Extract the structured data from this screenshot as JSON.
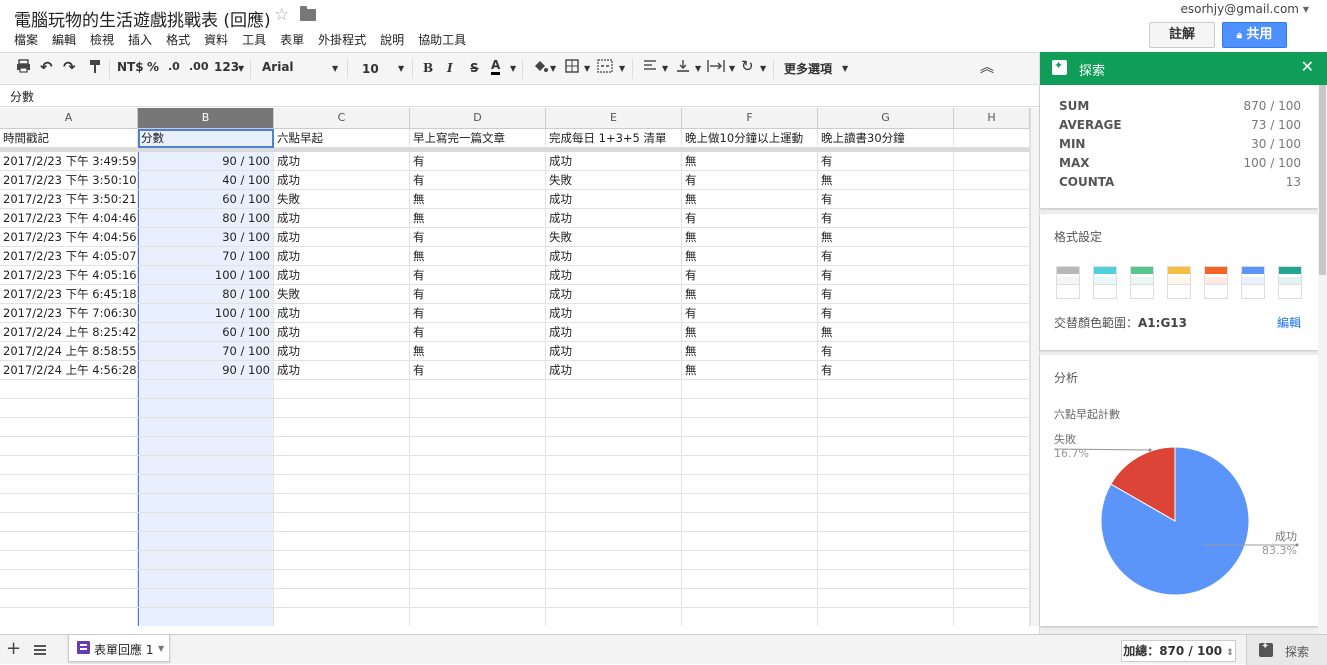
{
  "doc": {
    "title": "電腦玩物的生活遊戲挑戰表 (回應)"
  },
  "menu": [
    "檔案",
    "編輯",
    "檢視",
    "插入",
    "格式",
    "資料",
    "工具",
    "表單",
    "外掛程式",
    "說明",
    "協助工具"
  ],
  "user": {
    "email": "esorhjy@gmail.com"
  },
  "buttons": {
    "comments": "註解",
    "share": "共用"
  },
  "toolbar": {
    "currency": "NT$",
    "percent": "%",
    "dec_less": ".0",
    "dec_more": ".00",
    "format": "123",
    "font": "Arial",
    "size": "10",
    "bold": "B",
    "italic": "I",
    "strike": "S",
    "text_color": "A",
    "more": "更多選項"
  },
  "formula": {
    "value": "分數"
  },
  "grid": {
    "columns": [
      "A",
      "B",
      "C",
      "D",
      "E",
      "F",
      "G",
      "H"
    ],
    "header": [
      "時間戳記",
      "分數",
      "六點早起",
      "早上寫完一篇文章",
      "完成每日 1+3+5 清單",
      "晚上做10分鐘以上運動",
      "晚上讀書30分鐘"
    ],
    "rows": [
      [
        "2017/2/23 下午 3:49:59",
        "90 / 100",
        "成功",
        "有",
        "成功",
        "無",
        "有"
      ],
      [
        "2017/2/23 下午 3:50:10",
        "40 / 100",
        "成功",
        "有",
        "失敗",
        "有",
        "無"
      ],
      [
        "2017/2/23 下午 3:50:21",
        "60 / 100",
        "失敗",
        "無",
        "成功",
        "無",
        "有"
      ],
      [
        "2017/2/23 下午 4:04:46",
        "80 / 100",
        "成功",
        "無",
        "成功",
        "有",
        "有"
      ],
      [
        "2017/2/23 下午 4:04:56",
        "30 / 100",
        "成功",
        "有",
        "失敗",
        "無",
        "無"
      ],
      [
        "2017/2/23 下午 4:05:07",
        "70 / 100",
        "成功",
        "無",
        "成功",
        "無",
        "有"
      ],
      [
        "2017/2/23 下午 4:05:16",
        "100 / 100",
        "成功",
        "有",
        "成功",
        "有",
        "有"
      ],
      [
        "2017/2/23 下午 6:45:18",
        "80 / 100",
        "失敗",
        "有",
        "成功",
        "無",
        "有"
      ],
      [
        "2017/2/23 下午 7:06:30",
        "100 / 100",
        "成功",
        "有",
        "成功",
        "有",
        "有"
      ],
      [
        "2017/2/24 上午 8:25:42",
        "60 / 100",
        "成功",
        "有",
        "成功",
        "無",
        "無"
      ],
      [
        "2017/2/24 上午 8:58:55",
        "70 / 100",
        "成功",
        "無",
        "成功",
        "無",
        "有"
      ],
      [
        "2017/2/24 上午 4:56:28",
        "90 / 100",
        "成功",
        "有",
        "成功",
        "無",
        "有"
      ]
    ]
  },
  "explore": {
    "title": "探索",
    "stats": [
      {
        "label": "SUM",
        "value": "870 / 100"
      },
      {
        "label": "AVERAGE",
        "value": "73 / 100"
      },
      {
        "label": "MIN",
        "value": "30 / 100"
      },
      {
        "label": "MAX",
        "value": "100 / 100"
      },
      {
        "label": "COUNTA",
        "value": "13"
      }
    ],
    "format_title": "格式設定",
    "swatch_colors": [
      "#b7b7b7",
      "#4fd0dd",
      "#57c68f",
      "#f6bf41",
      "#f46524",
      "#5b95f9",
      "#27a594"
    ],
    "alt_color_label": "交替顏色範圍：",
    "alt_color_range": "A1:G13",
    "edit_link": "編輯",
    "analysis_title": "分析",
    "chart_label": "六點早起計數"
  },
  "chart_data": {
    "type": "pie",
    "title": "六點早起計數",
    "categories": [
      "失敗",
      "成功"
    ],
    "values": [
      16.7,
      83.3
    ],
    "value_labels": [
      "16.7%",
      "83.3%"
    ],
    "colors": [
      "#db4437",
      "#5b95f9"
    ]
  },
  "bottom": {
    "sheet_name": "表單回應 1",
    "sum_display": "加總：870 / 100",
    "explore_label": "探索"
  }
}
